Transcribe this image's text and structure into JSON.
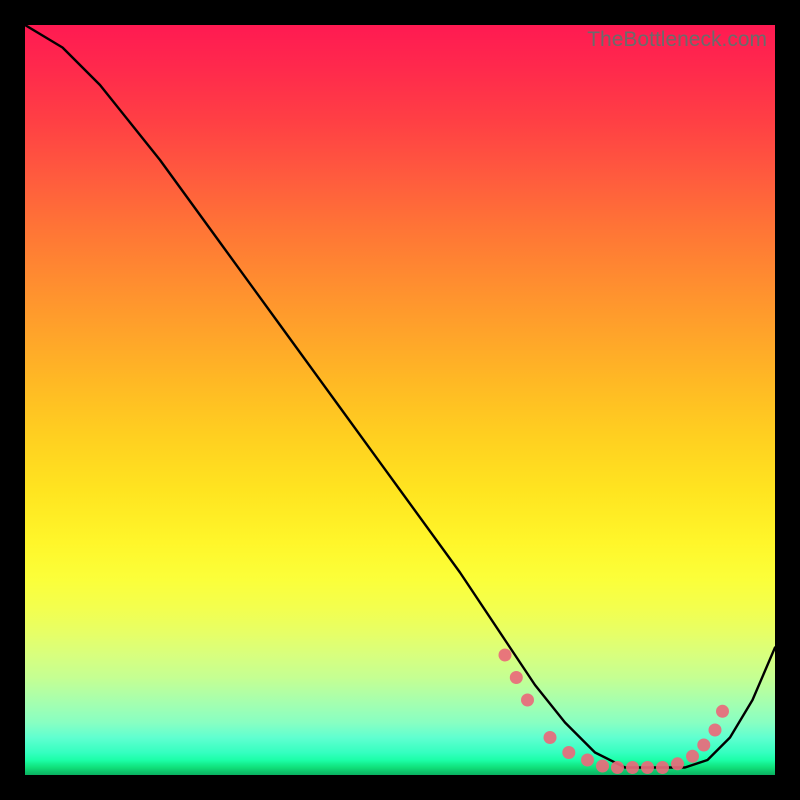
{
  "watermark": "TheBottleneck.com",
  "chart_data": {
    "type": "line",
    "title": "",
    "xlabel": "",
    "ylabel": "",
    "xlim": [
      0,
      100
    ],
    "ylim": [
      0,
      100
    ],
    "series": [
      {
        "name": "curve",
        "x": [
          0,
          5,
          10,
          18,
          26,
          34,
          42,
          50,
          58,
          64,
          68,
          72,
          76,
          80,
          84,
          88,
          91,
          94,
          97,
          100
        ],
        "y": [
          100,
          97,
          92,
          82,
          71,
          60,
          49,
          38,
          27,
          18,
          12,
          7,
          3,
          1,
          1,
          1,
          2,
          5,
          10,
          17
        ]
      }
    ],
    "markers": {
      "name": "data-points",
      "x": [
        64,
        65.5,
        67,
        70,
        72.5,
        75,
        77,
        79,
        81,
        83,
        85,
        87,
        89,
        90.5,
        92,
        93
      ],
      "y": [
        16,
        13,
        10,
        5,
        3,
        2,
        1.2,
        1,
        1,
        1,
        1,
        1.5,
        2.5,
        4,
        6,
        8.5
      ]
    },
    "gradient_stops": [
      {
        "pos": 0,
        "color": "#ff1a52"
      },
      {
        "pos": 50,
        "color": "#ffd020"
      },
      {
        "pos": 75,
        "color": "#fbff3a"
      },
      {
        "pos": 100,
        "color": "#0ab060"
      }
    ]
  }
}
